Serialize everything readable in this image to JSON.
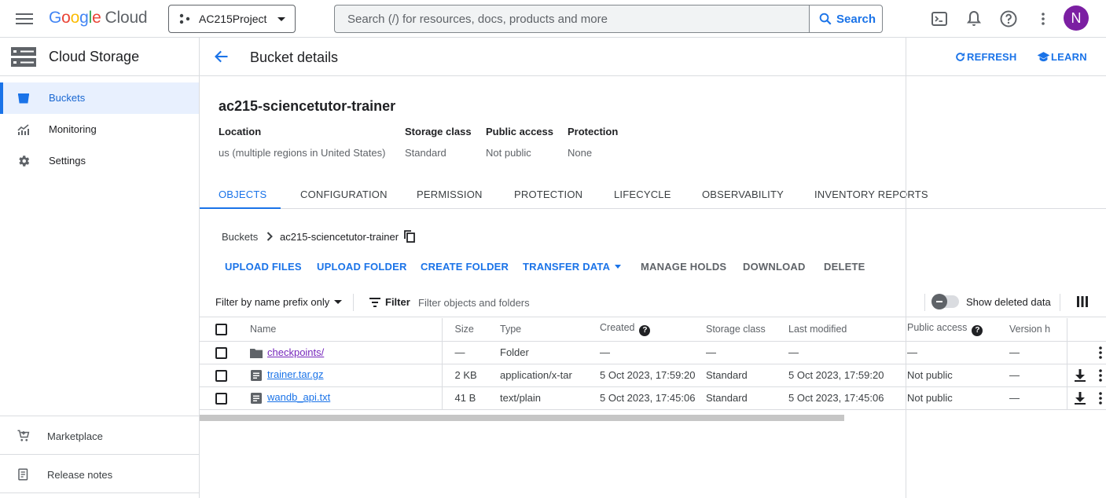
{
  "topbar": {
    "logo_letters": [
      "G",
      "o",
      "o",
      "g",
      "l",
      "e"
    ],
    "logo_product": "Cloud",
    "project": "AC215Project",
    "search_placeholder": "Search (/) for resources, docs, products and more",
    "search_button": "Search",
    "avatar_initial": "N",
    "icons": [
      "menu-icon",
      "terminal-icon",
      "bell-icon",
      "help-icon",
      "more-vert-icon"
    ]
  },
  "sidebar": {
    "product_title": "Cloud Storage",
    "items": [
      {
        "label": "Buckets",
        "icon": "bucket-icon",
        "active": true
      },
      {
        "label": "Monitoring",
        "icon": "chart-icon",
        "active": false
      },
      {
        "label": "Settings",
        "icon": "gear-icon",
        "active": false
      }
    ],
    "bottom": [
      {
        "label": "Marketplace",
        "icon": "cart-icon"
      },
      {
        "label": "Release notes",
        "icon": "notes-icon"
      }
    ]
  },
  "page": {
    "title": "Bucket details",
    "refresh": "REFRESH",
    "learn": "LEARN",
    "bucket_name": "ac215-sciencetutor-trainer",
    "meta": [
      {
        "key": "Location",
        "value": "us (multiple regions in United States)"
      },
      {
        "key": "Storage class",
        "value": "Standard"
      },
      {
        "key": "Public access",
        "value": "Not public"
      },
      {
        "key": "Protection",
        "value": "None"
      }
    ],
    "tabs": [
      "OBJECTS",
      "CONFIGURATION",
      "PERMISSION",
      "PROTECTION",
      "LIFECYCLE",
      "OBSERVABILITY",
      "INVENTORY REPORTS"
    ],
    "active_tab": "OBJECTS",
    "breadcrumb": {
      "root": "Buckets",
      "current": "ac215-sciencetutor-trainer"
    },
    "actions": [
      "UPLOAD FILES",
      "UPLOAD FOLDER",
      "CREATE FOLDER",
      "TRANSFER DATA",
      "MANAGE HOLDS",
      "DOWNLOAD",
      "DELETE"
    ],
    "filter": {
      "prefix_label": "Filter by name prefix only",
      "filter_label": "Filter",
      "placeholder": "Filter objects and folders",
      "show_deleted": "Show deleted data"
    },
    "table": {
      "headers": [
        "Name",
        "Size",
        "Type",
        "Created",
        "Storage class",
        "Last modified",
        "Public access",
        "Version h"
      ],
      "rows": [
        {
          "name": "checkpoints/",
          "kind": "folder",
          "size": "—",
          "type": "Folder",
          "created": "—",
          "storage": "—",
          "modified": "—",
          "public": "—",
          "version": "—"
        },
        {
          "name": "trainer.tar.gz",
          "kind": "file",
          "size": "2 KB",
          "type": "application/x-tar",
          "created": "5 Oct 2023, 17:59:20",
          "storage": "Standard",
          "modified": "5 Oct 2023, 17:59:20",
          "public": "Not public",
          "version": "—"
        },
        {
          "name": "wandb_api.txt",
          "kind": "file",
          "size": "41 B",
          "type": "text/plain",
          "created": "5 Oct 2023, 17:45:06",
          "storage": "Standard",
          "modified": "5 Oct 2023, 17:45:06",
          "public": "Not public",
          "version": "—"
        }
      ]
    }
  },
  "colors": {
    "accent": "#1a73e8",
    "visited_link": "#7627bb",
    "active_bg": "#e8f0fe",
    "avatar": "#7b1fa2"
  }
}
